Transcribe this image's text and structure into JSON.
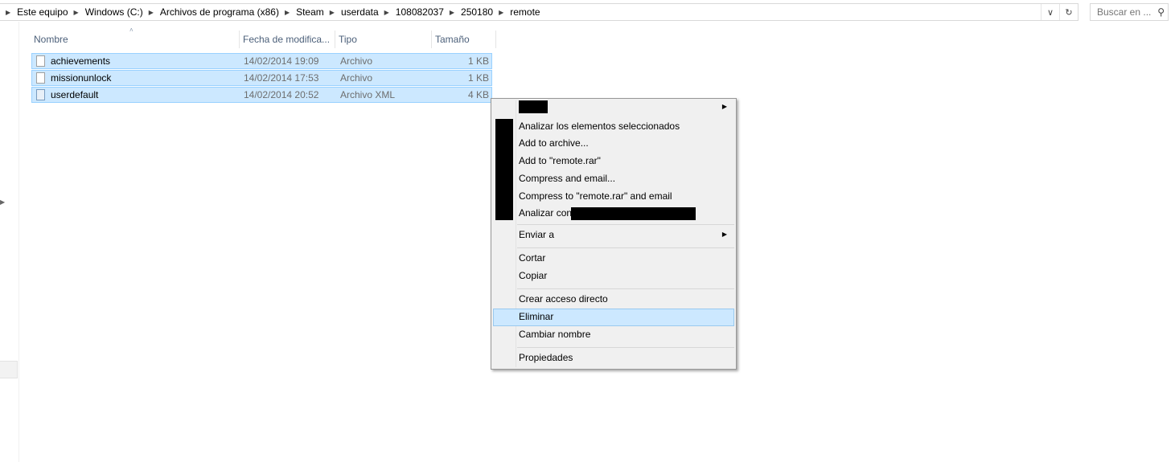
{
  "address_bar": {
    "crumbs": [
      "Este equipo",
      "Windows (C:)",
      "Archivos de programa (x86)",
      "Steam",
      "userdata",
      "108082037",
      "250180",
      "remote"
    ]
  },
  "search": {
    "placeholder": "Buscar en ..."
  },
  "columns": {
    "name": "Nombre",
    "date": "Fecha de modifica...",
    "type": "Tipo",
    "size": "Tamaño"
  },
  "files": [
    {
      "name": "achievements",
      "date": "14/02/2014 19:09",
      "type": "Archivo",
      "size": "1 KB"
    },
    {
      "name": "missionunlock",
      "date": "14/02/2014 17:53",
      "type": "Archivo",
      "size": "1 KB"
    },
    {
      "name": "userdefault",
      "date": "14/02/2014 20:52",
      "type": "Archivo XML",
      "size": "4 KB"
    }
  ],
  "context_menu": {
    "scan_selected": "Analizar los elementos seleccionados",
    "add_archive": "Add to archive...",
    "add_rar": "Add to \"remote.rar\"",
    "compress_email": "Compress and email...",
    "compress_rar_email": "Compress to \"remote.rar\" and email",
    "scan_with": "Analizar con",
    "send_to": "Enviar a",
    "cut": "Cortar",
    "copy": "Copiar",
    "create_shortcut": "Crear acceso directo",
    "delete": "Eliminar",
    "rename": "Cambiar nombre",
    "properties": "Propiedades"
  },
  "colors": {
    "selection": "#cce8ff",
    "selection_border": "#99d1ff",
    "menu_bg": "#f0f0f0",
    "header_text": "#4c607a"
  },
  "icons": [
    "chevron-right-icon",
    "dropdown-icon",
    "refresh-icon",
    "search-icon",
    "file-icon",
    "xml-file-icon",
    "submenu-arrow-icon",
    "sort-up-icon"
  ]
}
